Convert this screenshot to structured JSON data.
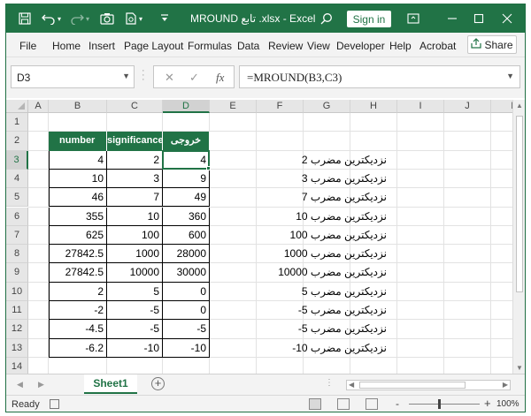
{
  "titlebar": {
    "title": "MROUND تابع .xlsx  -  Excel",
    "signin_label": "Sign in",
    "colors": {
      "accent": "#217346"
    }
  },
  "menu": {
    "items": [
      "File",
      "Home",
      "Insert",
      "Page Layout",
      "Formulas",
      "Data",
      "Review",
      "View",
      "Developer",
      "Help",
      "Acrobat"
    ],
    "share_label": "Share"
  },
  "formula_bar": {
    "name_box": "D3",
    "cancel_icon": "✕",
    "enter_icon": "✓",
    "fx_label": "fx",
    "formula": "=MROUND(B3,C3)"
  },
  "grid": {
    "columns": [
      "A",
      "B",
      "C",
      "D",
      "E",
      "F",
      "G",
      "H",
      "I",
      "J",
      "K"
    ],
    "rows": [
      "1",
      "2",
      "3",
      "4",
      "5",
      "6",
      "7",
      "8",
      "9",
      "10",
      "11",
      "12",
      "13",
      "14"
    ],
    "selected_column": "D",
    "selected_row": "3"
  },
  "table": {
    "headers": [
      "number",
      "significance",
      "خروجی"
    ],
    "rows": [
      [
        "4",
        "2",
        "4"
      ],
      [
        "10",
        "3",
        "9"
      ],
      [
        "46",
        "7",
        "49"
      ],
      [
        "355",
        "10",
        "360"
      ],
      [
        "625",
        "100",
        "600"
      ],
      [
        "27842.5",
        "1000",
        "28000"
      ],
      [
        "27842.5",
        "10000",
        "30000"
      ],
      [
        "2",
        "5",
        "0"
      ],
      [
        "-2",
        "-5",
        "0"
      ],
      [
        "-4.5",
        "-5",
        "-5"
      ],
      [
        "-6.2",
        "-10",
        "-10"
      ]
    ]
  },
  "notes": [
    "نزدیکترین مضرب 2",
    "نزدیکترین مضرب 3",
    "نزدیکترین مضرب 7",
    "نزدیکترین مضرب 10",
    "نزدیکترین مضرب 100",
    "نزدیکترین مضرب 1000",
    "نزدیکترین مضرب 10000",
    "نزدیکترین مضرب 5",
    "نزدیکترین مضرب 5-",
    "نزدیکترین مضرب 5-",
    "نزدیکترین مضرب 10-"
  ],
  "sheet_tabs": {
    "active": "Sheet1",
    "add_label": "+"
  },
  "status": {
    "ready": "Ready",
    "zoom_minus": "-",
    "zoom_plus": "+",
    "zoom": "100%"
  }
}
